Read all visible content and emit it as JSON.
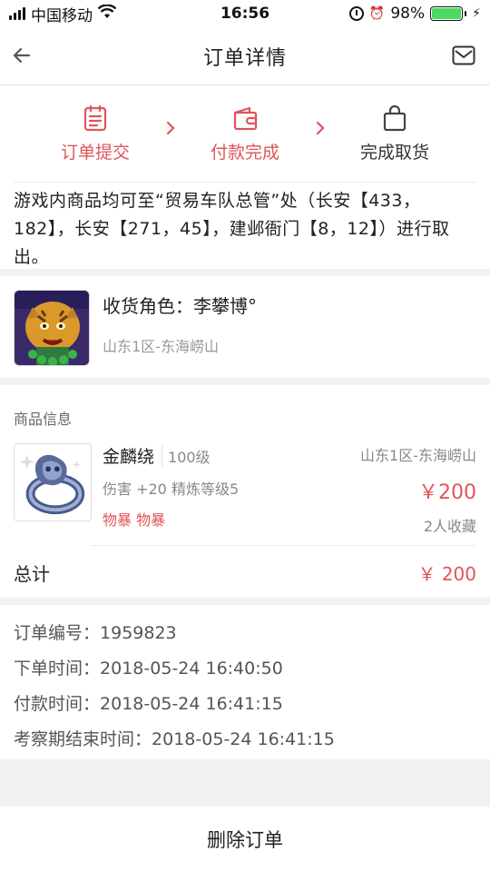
{
  "status_bar": {
    "carrier": "中国移动",
    "time": "16:56",
    "battery": "98%",
    "battery_level": 0.98
  },
  "nav": {
    "title": "订单详情",
    "back_icon": "back-arrow-icon",
    "mail_icon": "mail-icon"
  },
  "steps": [
    {
      "label": "订单提交",
      "icon": "clipboard-icon",
      "status": "done"
    },
    {
      "label": "付款完成",
      "icon": "wallet-icon",
      "status": "done"
    },
    {
      "label": "完成取货",
      "icon": "bag-icon",
      "status": "todo"
    }
  ],
  "colors": {
    "accent": "#e0545a",
    "background": "#f2f2f2"
  },
  "notice": "游戏内商品均可至“贸易车队总管”处（长安【433，182】，长安【271，45】，建邺衙门【8，12】）进行取出。",
  "receiver": {
    "label": "收货角色：",
    "name": "李攀博°",
    "server": "山东1区-东海崂山"
  },
  "goods": {
    "header": "商品信息",
    "item": {
      "name": "金麟绕",
      "level": "100级",
      "attr": "伤害 +20 精炼等级5",
      "tags": "物暴 物暴",
      "server": "山东1区-东海崂山",
      "price": "￥200",
      "favorites": "2人收藏"
    },
    "total_label": "总计",
    "total_value": "￥ 200"
  },
  "order_info": {
    "order_no_label": "订单编号：",
    "order_no": "1959823",
    "order_time_label": "下单时间：",
    "order_time": "2018-05-24 16:40:50",
    "pay_time_label": "付款时间：",
    "pay_time": "2018-05-24 16:41:15",
    "review_end_label": "考察期结束时间：",
    "review_end": "2018-05-24 16:41:15"
  },
  "bottom_button": "删除订单"
}
